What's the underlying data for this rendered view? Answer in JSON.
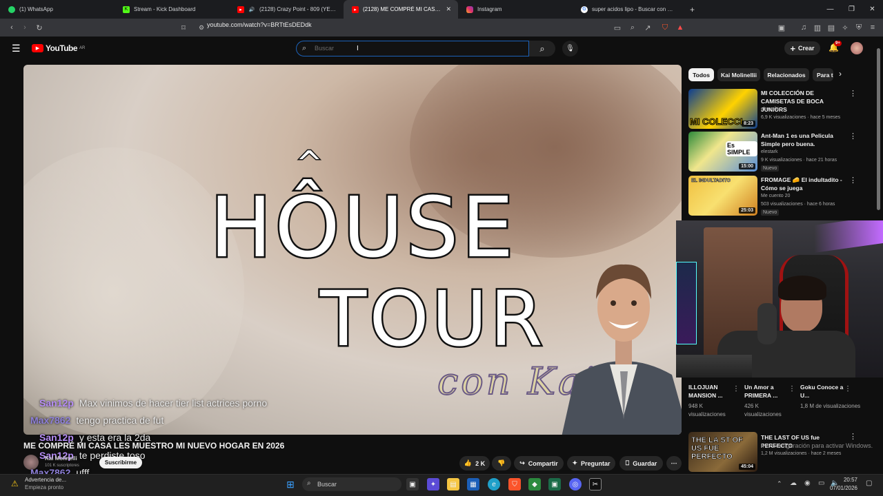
{
  "browser": {
    "tabs": [
      {
        "title": "(1) WhatsApp",
        "color": "#25d366",
        "icon": "whatsapp-icon"
      },
      {
        "title": "Stream - Kick Dashboard",
        "color": "#53fc18",
        "icon": "kick-icon"
      },
      {
        "title": "(2128) Crazy Point - 809 (YEI808",
        "color": "#ff0000",
        "icon": "youtube-icon"
      },
      {
        "title": "(2128) ME COMPRÉ MI CASA LE",
        "color": "#ff0000",
        "icon": "youtube-icon"
      },
      {
        "title": "Instagram",
        "color": "#e1306c",
        "icon": "instagram-icon"
      },
      {
        "title": "super acidos lipo - Buscar con Googl",
        "color": "#ffffff",
        "icon": "google-icon"
      }
    ],
    "new_tab": "+",
    "url": "youtube.com/watch?v=BRTtEsDEDdk"
  },
  "youtube": {
    "logo_text": "YouTube",
    "country": "AR",
    "search_placeholder": "Buscar",
    "create_label": "Crear",
    "notif_count": "9+"
  },
  "video": {
    "thumb_line1": "HÔUSE",
    "thumb_accent": "^",
    "thumb_line2": "TOUR",
    "thumb_script": "con Kai",
    "title": "ME COMPRÉ MI CASA LES MUESTRO MI NUEVO HOGAR EN 2026",
    "channel": "Kai Molinelli",
    "subs": "101 K suscriptores",
    "subscribe": "Suscribirme",
    "likes": "2 K",
    "share": "Compartir",
    "ask": "Preguntar",
    "save": "Guardar"
  },
  "chat": [
    {
      "user": "San12p",
      "msg": "Max vinimos de hacer tier list actrices porno",
      "color": "#b58cf5"
    },
    {
      "user": "Max7862",
      "msg": "tengo practica de fut",
      "color": "#8d7fd8"
    },
    {
      "user": "San12p",
      "msg": "y esta era la 2da",
      "color": "#b58cf5"
    },
    {
      "user": "San12p",
      "msg": "te perdiste toso",
      "color": "#b58cf5"
    },
    {
      "user": "Max7862",
      "msg": "ufff",
      "color": "#8d7fd8"
    }
  ],
  "sidebar": {
    "chips": [
      "Todos",
      "Kai Molinellii",
      "Relacionados",
      "Para ti"
    ],
    "recs": [
      {
        "title": "MI COLECCIÓN DE CAMISETAS DE BOCA JUNIORS",
        "channel": "elreyniki",
        "meta": "6,9 K visualizaciones · hace 5 meses",
        "duration": "8:23",
        "thumb_text": "MI COLECCI",
        "badge": ""
      },
      {
        "title": "Ant-Man 1 es una Pelicula Simple pero buena.",
        "channel": "elestark",
        "meta": "9 K visualizaciones · hace 21 horas",
        "duration": "15:00",
        "thumb_text": "Es SIMPLE",
        "badge": "Nuevo"
      },
      {
        "title": "FROMAGE 🧀 El indultadito - Cómo se juega",
        "channel": "Me cuento 20",
        "meta": "503 visualizaciones · hace 6 horas",
        "duration": "25:03",
        "thumb_text": "EL INDULTADITO",
        "badge": "Nuevo"
      }
    ],
    "shorts": [
      {
        "title": "ILLOJUAN MANSION ...",
        "views": "948 K visualizaciones"
      },
      {
        "title": "Un Amor a PRIMERA ...",
        "views": "426 K visualizaciones"
      },
      {
        "title": "Goku Conoce a U...",
        "views": "1,8 M de visualizaciones"
      }
    ],
    "bottom_rec": {
      "title": "THE LAST OF US fue PERFECTO",
      "meta": "1,2 M visualizaciones · hace 2 meses",
      "duration": "45:04",
      "thumb_text": "THE LA ST OF US FUE PERFECTO"
    },
    "watermark": "Ir a Configuración para activar Windows."
  },
  "taskbar": {
    "warning": "Advertencia de...",
    "warning_sub": "Empieza pronto",
    "search": "Buscar",
    "time": "20:57",
    "date": "07/01/2026"
  }
}
